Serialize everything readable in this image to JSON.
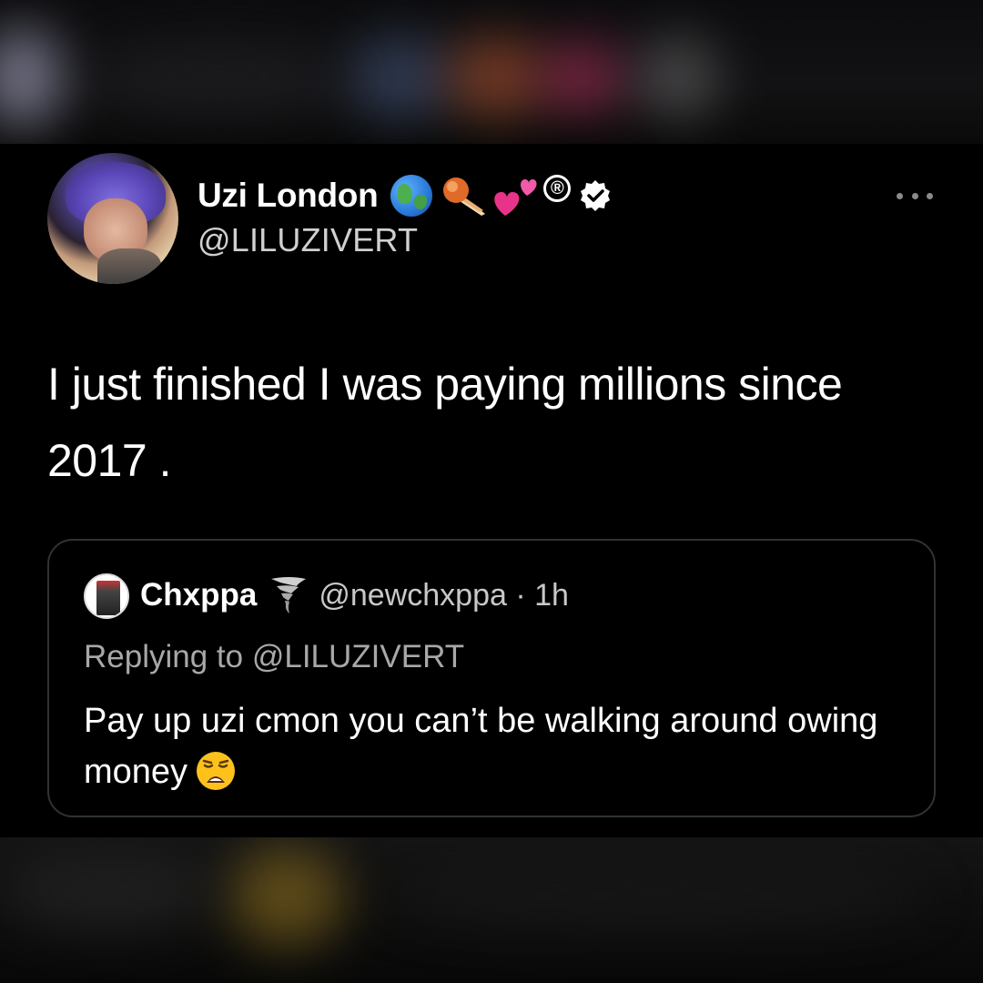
{
  "tweet": {
    "display_name": "Uzi London",
    "name_emojis": [
      "globe-icon",
      "comet-icon",
      "two-hearts-icon"
    ],
    "registered_mark": "®",
    "handle": "@LILUZIVERT",
    "text": "I just finished I was paying millions since 2017 ."
  },
  "quoted_tweet": {
    "display_name": "Chxppa",
    "name_emoji": "tornado-icon",
    "handle_time": "@newchxppa · 1h",
    "replying_to": "Replying to @LILUZIVERT",
    "text": "Pay up uzi cmon you can’t be walking around owing money",
    "trailing_emoji": "weary-face-icon"
  },
  "colors": {
    "background": "#000000",
    "primary_text": "#ffffff",
    "secondary_text": "#a8a8a8",
    "border": "#2f3336"
  }
}
